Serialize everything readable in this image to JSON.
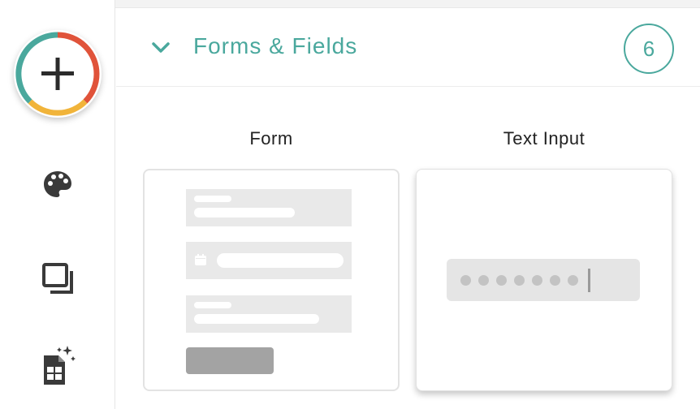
{
  "rail": {
    "add": {
      "icon": "plus-icon",
      "ring_colors": [
        "#e0533a",
        "#f1b43a",
        "#4aa89d"
      ]
    },
    "items": [
      {
        "icon": "palette-icon"
      },
      {
        "icon": "layers-icon"
      },
      {
        "icon": "spreadsheet-sparkle-icon"
      }
    ]
  },
  "section": {
    "title": "Forms & Fields",
    "count": "6",
    "expanded": true,
    "accent": "#4aa89d"
  },
  "components": [
    {
      "label": "Form",
      "preview": "form-preview"
    },
    {
      "label": "Text Input",
      "preview": "text-input-preview",
      "masked_dots": 7
    }
  ]
}
